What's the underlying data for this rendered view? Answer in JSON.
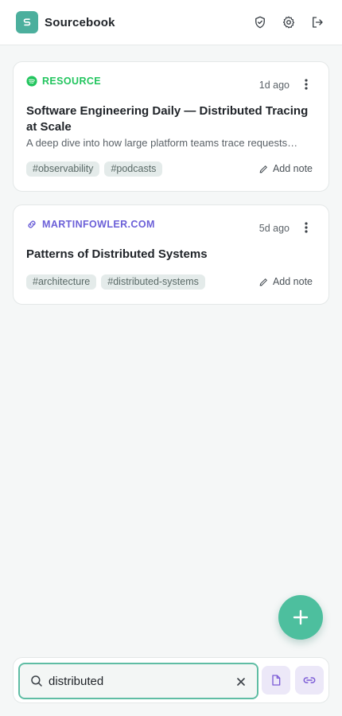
{
  "app": {
    "title": "Sourcebook",
    "logo_letter": "S",
    "accent": "#4caf9d"
  },
  "header": {
    "actions": [
      {
        "icon": "shield-check-icon",
        "label": "privacy"
      },
      {
        "icon": "gear-icon",
        "label": "settings"
      },
      {
        "icon": "logout-icon",
        "label": "log out"
      }
    ]
  },
  "cards": [
    {
      "source_label": "RESOURCE",
      "source_icon": "spotify-icon",
      "source_color": "#1ed760",
      "time": "1d ago",
      "title": "Software Engineering Daily — Distributed Tracing at Scale",
      "description": "A deep dive into how large platform teams trace requests…",
      "tags": [
        "#observability",
        "#podcasts"
      ],
      "add_note_label": "Add note"
    },
    {
      "source_label": "MARTINFOWLER.COM",
      "source_icon": "link-icon",
      "source_color": "#6b5fd8",
      "time": "5d ago",
      "title": "Patterns of Distributed Systems",
      "tags": [
        "#architecture",
        "#distributed-systems"
      ],
      "add_note_label": "Add note"
    }
  ],
  "search": {
    "value": "distributed",
    "placeholder": "Search"
  },
  "filters": [
    {
      "icon": "file-icon",
      "label": "documents"
    },
    {
      "icon": "link-icon",
      "label": "links"
    }
  ],
  "fab": {
    "icon": "plus-icon"
  }
}
